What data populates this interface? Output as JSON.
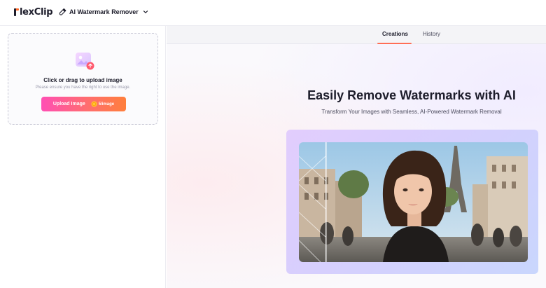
{
  "app": {
    "logo_text": "lexClip",
    "tool_name": "AI Watermark Remover"
  },
  "upload": {
    "title": "Click or drag to upload image",
    "note": "Please ensure you have the right to use the image.",
    "button_label": "Upload Image",
    "price": "5/image"
  },
  "tabs": [
    {
      "label": "Creations",
      "active": true
    },
    {
      "label": "History",
      "active": false
    }
  ],
  "hero": {
    "title": "Easily Remove Watermarks with AI",
    "subtitle": "Transform Your Images with Seamless, AI-Powered Watermark Removal"
  },
  "colors": {
    "accent_gradient_start": "#ff4fb4",
    "accent_gradient_end": "#ff7f3c",
    "tab_underline": "#ff6e55",
    "brand_orange": "#ff6a2b"
  },
  "icons": [
    "eraser-icon",
    "chevron-down-icon",
    "image-upload-icon",
    "coin-icon"
  ]
}
